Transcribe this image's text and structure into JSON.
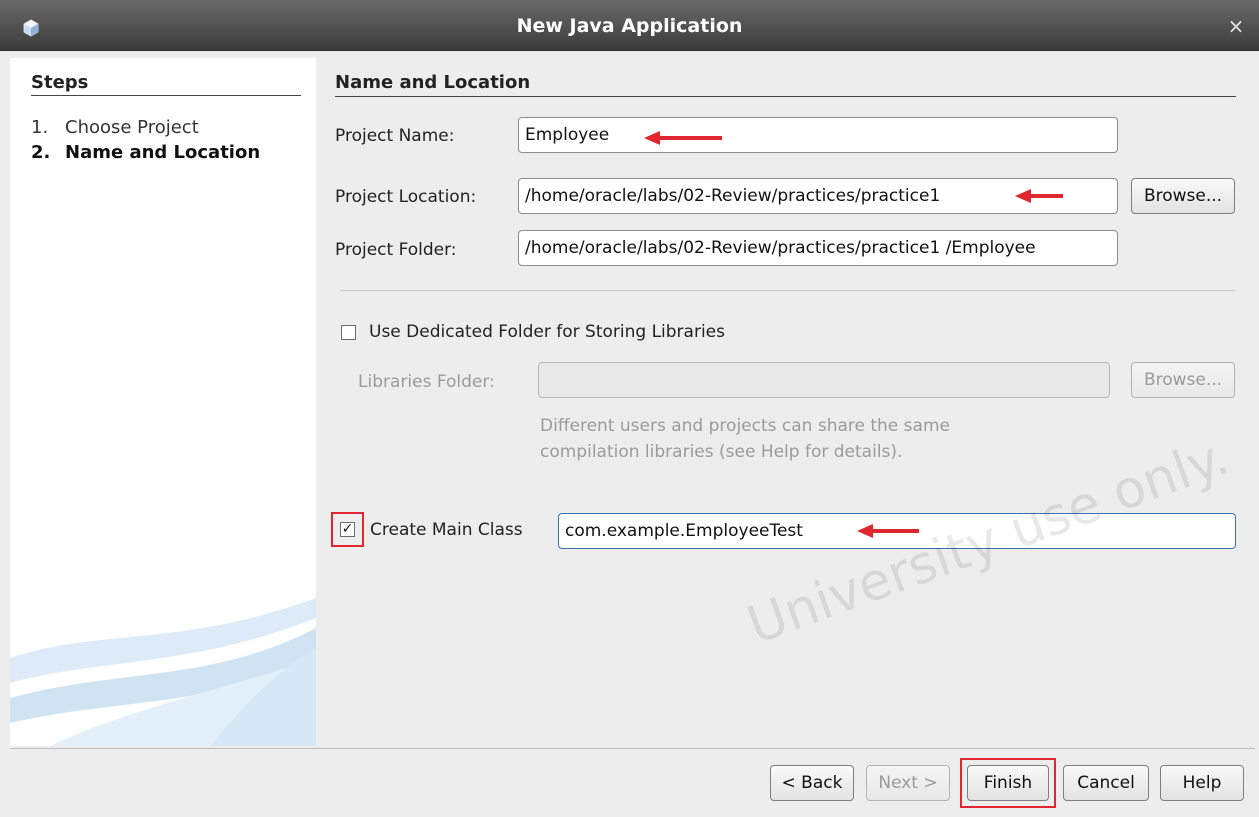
{
  "window": {
    "title": "New Java Application",
    "close_glyph": "×"
  },
  "steps": {
    "title": "Steps",
    "items": [
      {
        "num": "1.",
        "label": "Choose Project"
      },
      {
        "num": "2.",
        "label": "Name and Location"
      }
    ]
  },
  "panel": {
    "title": "Name and Location"
  },
  "form": {
    "project_name_label": "Project Name:",
    "project_name_value": "Employee",
    "project_location_label": "Project Location:",
    "project_location_value": "/home/oracle/labs/02-Review/practices/practice1",
    "project_location_browse": "Browse...",
    "project_folder_label": "Project Folder:",
    "project_folder_value": "/home/oracle/labs/02-Review/practices/practice1 /Employee",
    "dedicated_folder_label": "Use Dedicated Folder for Storing Libraries",
    "dedicated_folder_checked": false,
    "libraries_folder_label": "Libraries Folder:",
    "libraries_folder_value": "",
    "libraries_browse": "Browse...",
    "libraries_help_line1": "Different users and projects can share the same",
    "libraries_help_line2": "compilation libraries (see Help for details).",
    "main_class_label": "Create Main Class",
    "main_class_checked": true,
    "main_class_value": "com.example.EmployeeTest",
    "check_glyph": "✓"
  },
  "buttons": {
    "back": "< Back",
    "next": "Next >",
    "finish": "Finish",
    "cancel": "Cancel",
    "help": "Help"
  },
  "watermark": "University use only.",
  "colors": {
    "titlebar": "#4a4a4a",
    "annotation_red": "#e0262e",
    "focus_blue": "#3c6fb4",
    "panel_bg": "#ededed"
  },
  "icons": {
    "app": "cube-icon",
    "close": "close-icon",
    "annotation": "red-arrow-icon"
  }
}
